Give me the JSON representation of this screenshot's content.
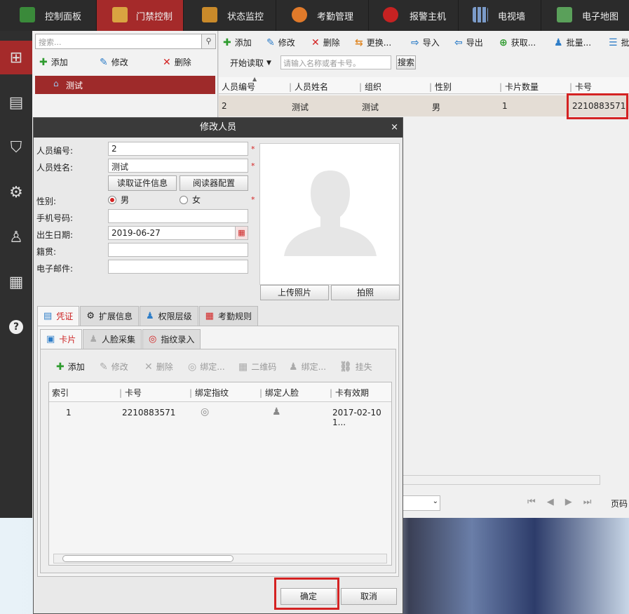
{
  "topnav": [
    "控制面板",
    "门禁控制",
    "状态监控",
    "考勤管理",
    "报警主机",
    "电视墙",
    "电子地图"
  ],
  "tree": {
    "search_placeholder": "搜索...",
    "add": "添加",
    "edit": "修改",
    "delete": "删除",
    "item": "测试"
  },
  "toolbar": {
    "add": "添加",
    "edit": "修改",
    "delete": "删除",
    "replace": "更换...",
    "import": "导入",
    "export": "导出",
    "fetch": "获取...",
    "batch": "批量...",
    "more": "批"
  },
  "filter": {
    "start_read": "开始读取",
    "placeholder": "请输入名称或者卡号。",
    "search": "搜索"
  },
  "table": {
    "headers": [
      "人员编号",
      "人员姓名",
      "组织",
      "性别",
      "卡片数量",
      "卡号"
    ],
    "row": [
      "2",
      "测试",
      "测试",
      "男",
      "1",
      "2210883571"
    ]
  },
  "pager": {
    "page_label": "页码"
  },
  "dialog": {
    "title": "修改人员",
    "close": "×",
    "labels": {
      "id": "人员编号:",
      "name": "人员姓名:",
      "gender": "性别:",
      "phone": "手机号码:",
      "birth": "出生日期:",
      "native": "籍贯:",
      "email": "电子邮件:"
    },
    "values": {
      "id": "2",
      "name": "测试",
      "birth": "2019-06-27",
      "phone": "",
      "native": "",
      "email": ""
    },
    "read_id": "读取证件信息",
    "reader_cfg": "阅读器配置",
    "male": "男",
    "female": "女",
    "upload": "上传照片",
    "capture": "拍照",
    "tabs": [
      "凭证",
      "扩展信息",
      "权限层级",
      "考勤规则"
    ],
    "subtabs": [
      "卡片",
      "人脸采集",
      "指纹录入"
    ],
    "card_toolbar": [
      "添加",
      "修改",
      "删除",
      "绑定...",
      "二维码",
      "绑定...",
      "挂失"
    ],
    "card_headers": [
      "索引",
      "卡号",
      "绑定指纹",
      "绑定人脸",
      "卡有效期"
    ],
    "card_row": [
      "1",
      "2210883571",
      "",
      "",
      "2017-02-10 1..."
    ],
    "ok": "确定",
    "cancel": "取消"
  }
}
